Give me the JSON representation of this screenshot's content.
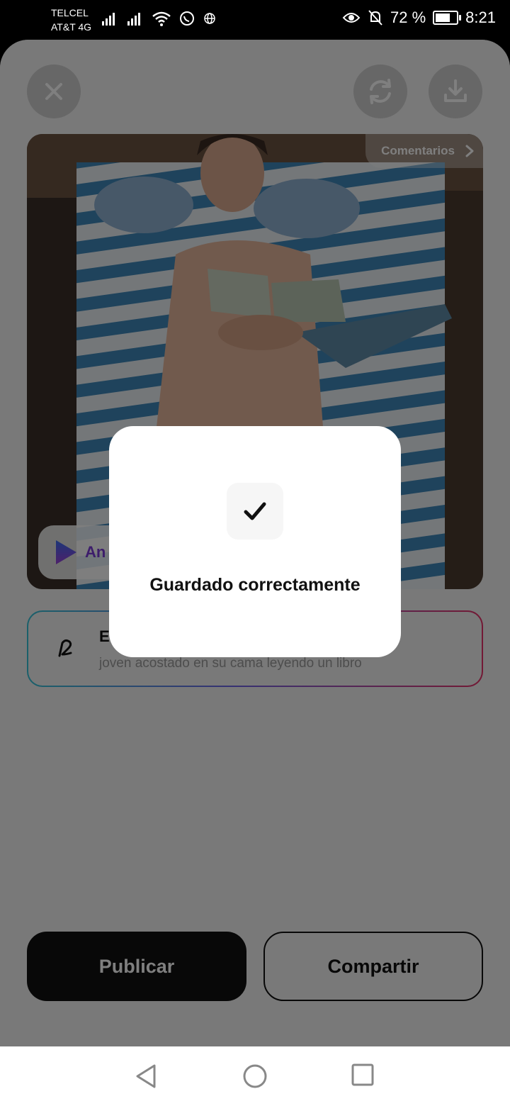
{
  "status_bar": {
    "carrier_1": "TELCEL",
    "carrier_2": "AT&T 4G",
    "battery_percent": "72 %",
    "battery_level": 0.72,
    "time": "8:21"
  },
  "toolbar": {
    "close_icon": "close-icon",
    "regenerate_icon": "refresh-icon",
    "download_icon": "download-icon"
  },
  "image_card": {
    "comments_label": "Comentarios",
    "animate_label": "An",
    "image_description_icon": "generated-image"
  },
  "prompt": {
    "title": "E",
    "text": "joven acostado en su cama  leyendo un libro"
  },
  "actions": {
    "publish_label": "Publicar",
    "share_label": "Compartir"
  },
  "dialog": {
    "message": "Guardado correctamente",
    "icon": "check-icon"
  },
  "colors": {
    "gradient_start": "#37c2d6",
    "gradient_mid": "#6d63e6",
    "gradient_end": "#e6336a",
    "accent_purple": "#7a3ad6"
  }
}
